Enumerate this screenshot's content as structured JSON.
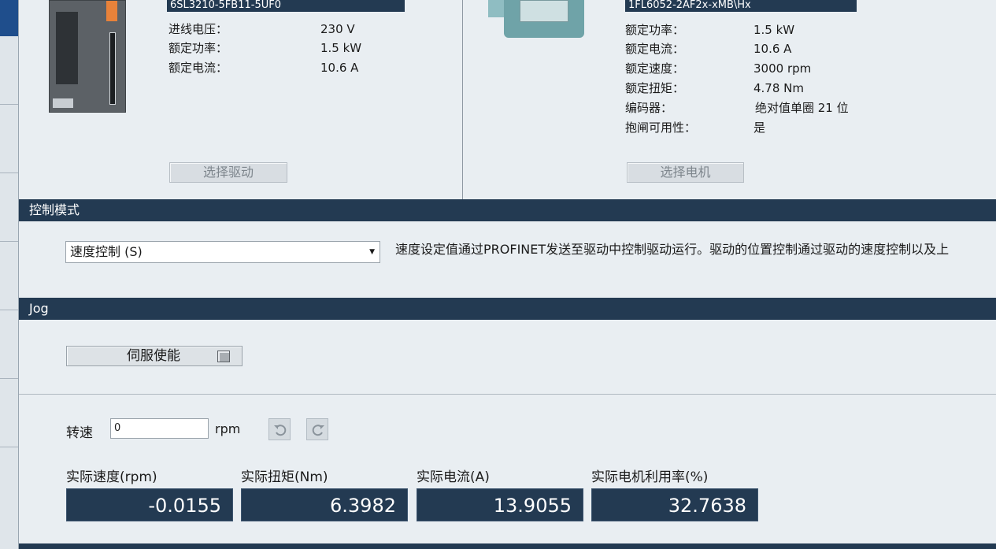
{
  "drive": {
    "model": "6SL3210-5FB11-5UF0",
    "specs": [
      {
        "label": "进线电压：",
        "value": "230 V"
      },
      {
        "label": "额定功率：",
        "value": "1.5 kW"
      },
      {
        "label": "额定电流：",
        "value": "10.6 A"
      }
    ],
    "select_label": "选择驱动"
  },
  "motor": {
    "model": "1FL6052-2AF2x-xMB\\Hx",
    "specs": [
      {
        "label": "额定功率：",
        "value": "1.5 kW"
      },
      {
        "label": "额定电流：",
        "value": "10.6 A"
      },
      {
        "label": "额定速度：",
        "value": "3000 rpm"
      },
      {
        "label": "额定扭矩：",
        "value": "4.78 Nm"
      },
      {
        "label": "编码器：",
        "value": "绝对值单圈 21 位"
      },
      {
        "label": "抱闸可用性：",
        "value": "是"
      }
    ],
    "select_label": "选择电机"
  },
  "control_mode": {
    "title": "控制模式",
    "selected": "速度控制 (S)",
    "description": "速度设定值通过PROFINET发送至驱动中控制驱动运行。驱动的位置控制通过驱动的速度控制以及上"
  },
  "jog": {
    "title": "Jog",
    "servo_enable_label": "伺服使能",
    "speed_label": "转速",
    "speed_value": "0",
    "speed_unit": "rpm"
  },
  "meters": [
    {
      "label": "实际速度(rpm)",
      "value": "-0.0155"
    },
    {
      "label": "实际扭矩(Nm)",
      "value": "6.3982"
    },
    {
      "label": "实际电流(A)",
      "value": "13.9055"
    },
    {
      "label": "实际电机利用率(%)",
      "value": "32.7638"
    }
  ],
  "icons": {
    "ccw": "rotate-ccw-icon",
    "cw": "rotate-cw-icon",
    "dropdown": "dropdown-arrow-icon",
    "checkbox": "checkbox-icon"
  },
  "colors": {
    "header_bar": "#233a52",
    "background": "#e9eef2",
    "accent_blue": "#1f4e8c"
  }
}
